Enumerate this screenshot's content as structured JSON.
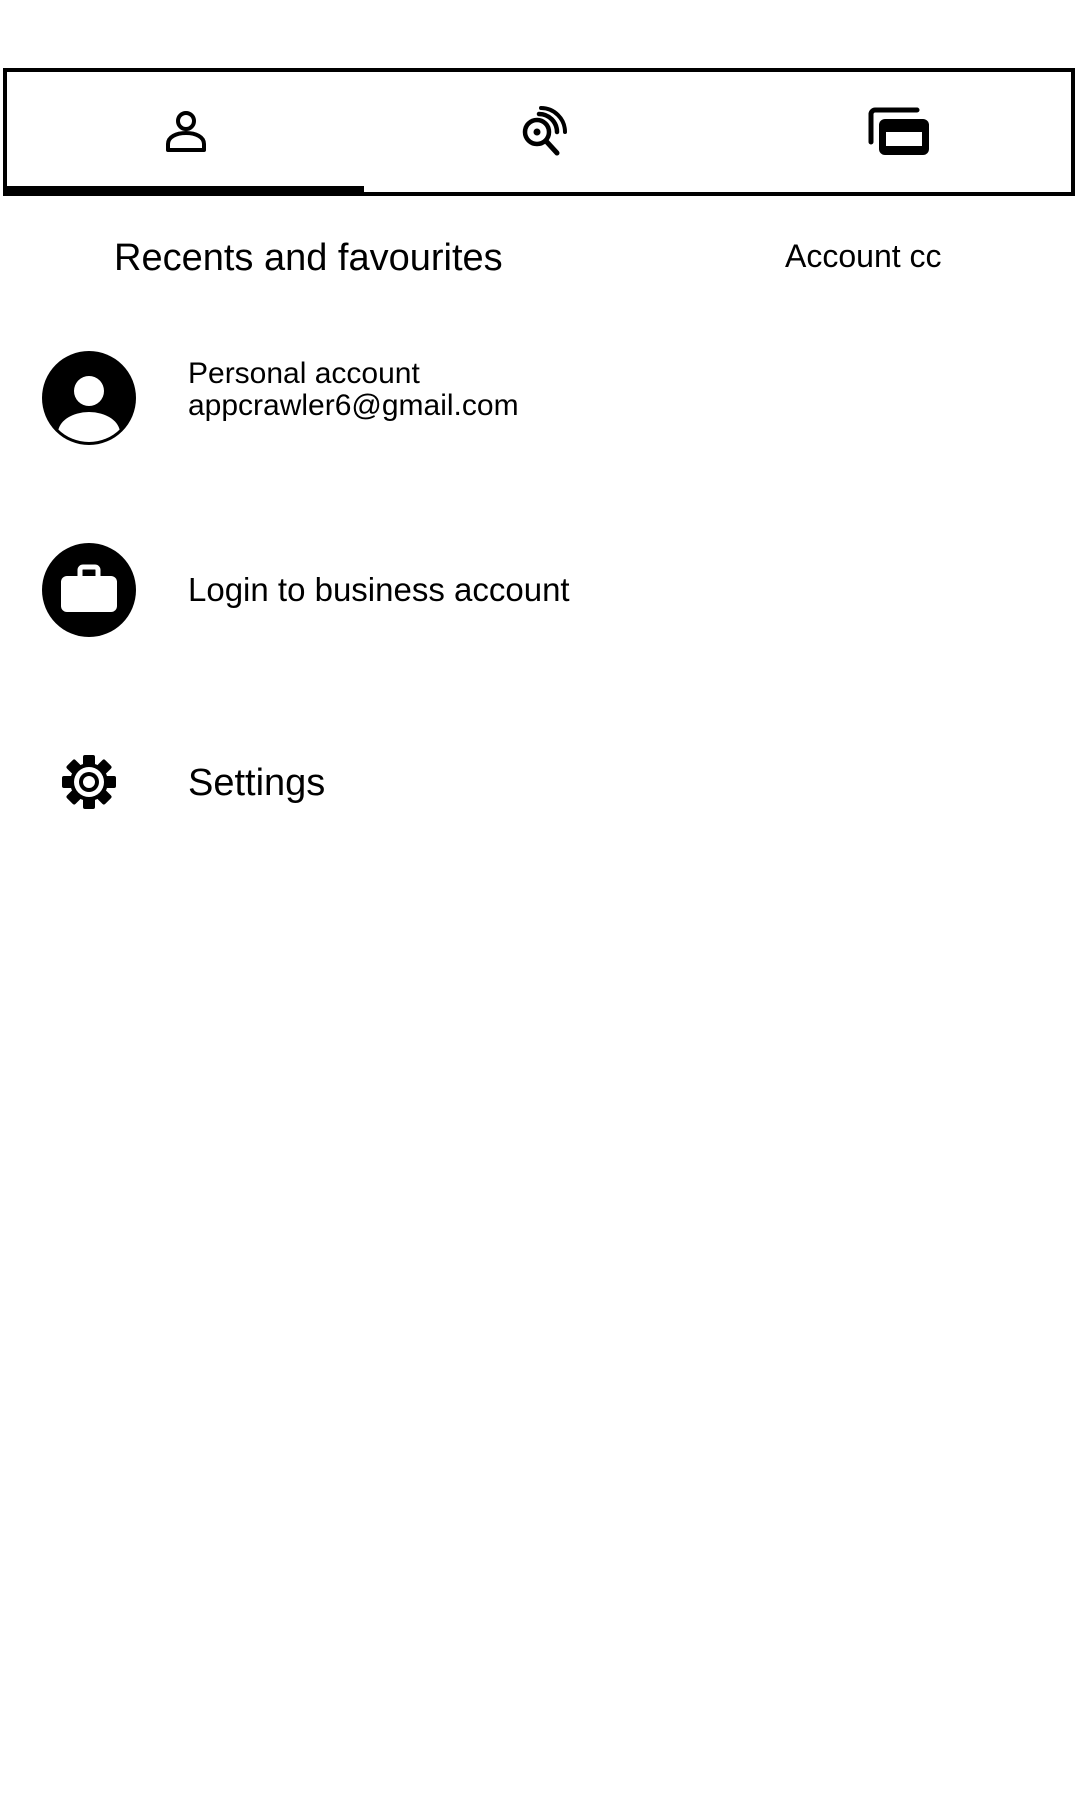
{
  "tabs": [
    {
      "id": "account",
      "icon": "person-icon",
      "selected": true
    },
    {
      "id": "search",
      "icon": "search-signal-icon",
      "selected": false
    },
    {
      "id": "cards",
      "icon": "cards-icon",
      "selected": false
    }
  ],
  "header": {
    "title": "Recents and favourites",
    "secondary": "Account cc"
  },
  "accounts": {
    "personal": {
      "title": "Personal account",
      "email": "appcrawler6@gmail.com",
      "icon": "avatar-person-icon"
    },
    "business": {
      "label": "Login to business account",
      "icon": "briefcase-icon"
    }
  },
  "settings": {
    "label": "Settings",
    "icon": "gear-icon"
  },
  "colors": {
    "foreground": "#000000",
    "background": "#ffffff"
  }
}
